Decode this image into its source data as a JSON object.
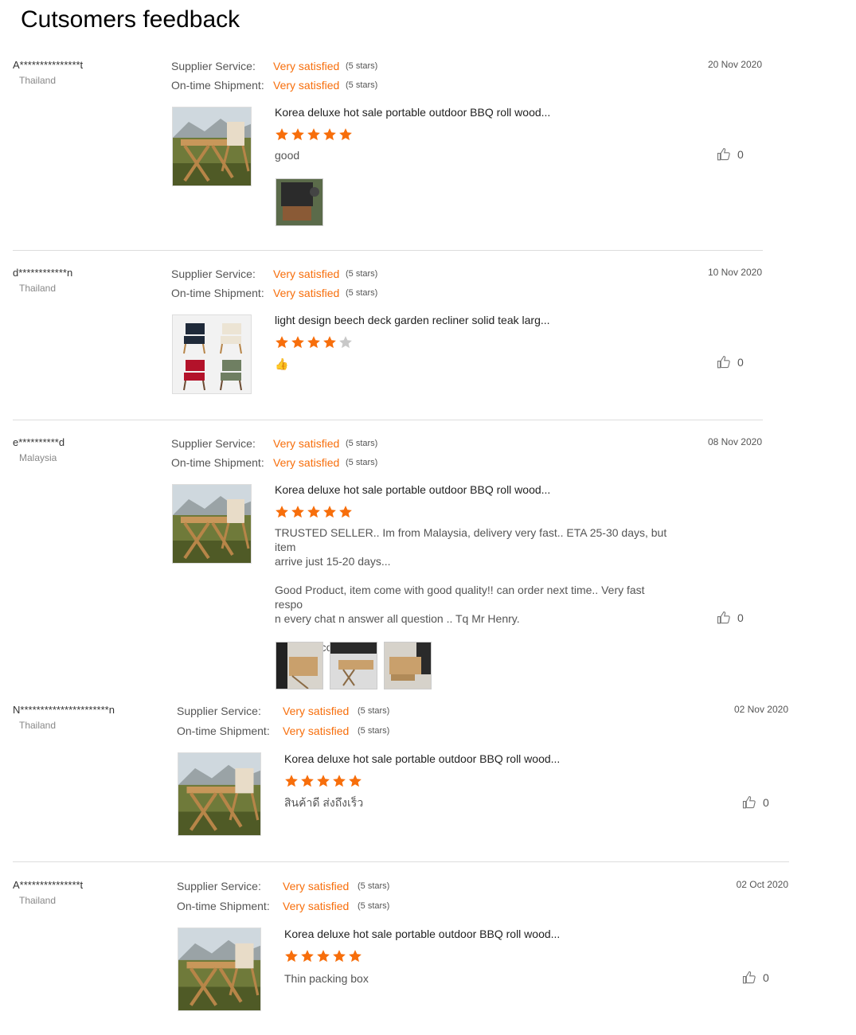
{
  "page": {
    "title": "Cutsomers feedback"
  },
  "colors": {
    "accent": "#f76e0b",
    "star_off": "#c8c8c8",
    "divider": "#dddddd"
  },
  "labels": {
    "supplier_service": "Supplier Service:",
    "ontime_shipment": "On-time Shipment:"
  },
  "reviews": [
    {
      "name": "A***************t",
      "country": "Thailand",
      "date": "20 Nov 2020",
      "supplier_rating": "Very satisfied",
      "supplier_stars": "(5 stars)",
      "shipment_rating": "Very satisfied",
      "shipment_stars": "(5 stars)",
      "product": "Korea deluxe hot sale portable outdoor BBQ roll wood...",
      "product_image": "wood-table-image",
      "stars": 5,
      "comment": "good",
      "likes": "0",
      "photos": [
        "bbq-grill-photo"
      ]
    },
    {
      "name": "d************n",
      "country": "Thailand",
      "date": "10 Nov 2020",
      "supplier_rating": "Very satisfied",
      "supplier_stars": "(5 stars)",
      "shipment_rating": "Very satisfied",
      "shipment_stars": "(5 stars)",
      "product": "light design beech deck garden recliner solid teak larg...",
      "product_image": "chairs-image",
      "stars": 4,
      "comment": "👍",
      "likes": "0",
      "photos": []
    },
    {
      "name": "e**********d",
      "country": "Malaysia",
      "date": "08 Nov 2020",
      "supplier_rating": "Very satisfied",
      "supplier_stars": "(5 stars)",
      "shipment_rating": "Very satisfied",
      "shipment_stars": "(5 stars)",
      "product": "Korea deluxe hot sale portable outdoor BBQ roll wood...",
      "product_image": "wood-table-image",
      "stars": 5,
      "comment_lines": [
        "TRUSTED SELLER.. Im from Malaysia, delivery very fast.. ETA 25-30 days, but item",
        "arrive just 15-20 days...",
        "",
        "Good Product, item come with good quality!! can order next time.. Very fast respo",
        "n every chat n answer all question .. Tq Mr Henry.",
        "",
        "100% Recomended"
      ],
      "likes": "0",
      "photos": [
        "table-photo-1",
        "table-photo-2",
        "table-photo-3"
      ]
    },
    {
      "name": "N**********************n",
      "country": "Thailand",
      "date": "02 Nov 2020",
      "supplier_rating": "Very satisfied",
      "supplier_stars": "(5 stars)",
      "shipment_rating": "Very satisfied",
      "shipment_stars": "(5 stars)",
      "product": "Korea deluxe hot sale portable outdoor BBQ roll wood...",
      "product_image": "wood-table-image",
      "stars": 5,
      "comment": "สินค้าดี ส่งถึงเร็ว",
      "likes": "0",
      "photos": []
    },
    {
      "name": "A***************t",
      "country": "Thailand",
      "date": "02 Oct 2020",
      "supplier_rating": "Very satisfied",
      "supplier_stars": "(5 stars)",
      "shipment_rating": "Very satisfied",
      "shipment_stars": "(5 stars)",
      "product": "Korea deluxe hot sale portable outdoor BBQ roll wood...",
      "product_image": "wood-table-image",
      "stars": 5,
      "comment": "Thin packing box",
      "likes": "0",
      "photos": []
    }
  ]
}
